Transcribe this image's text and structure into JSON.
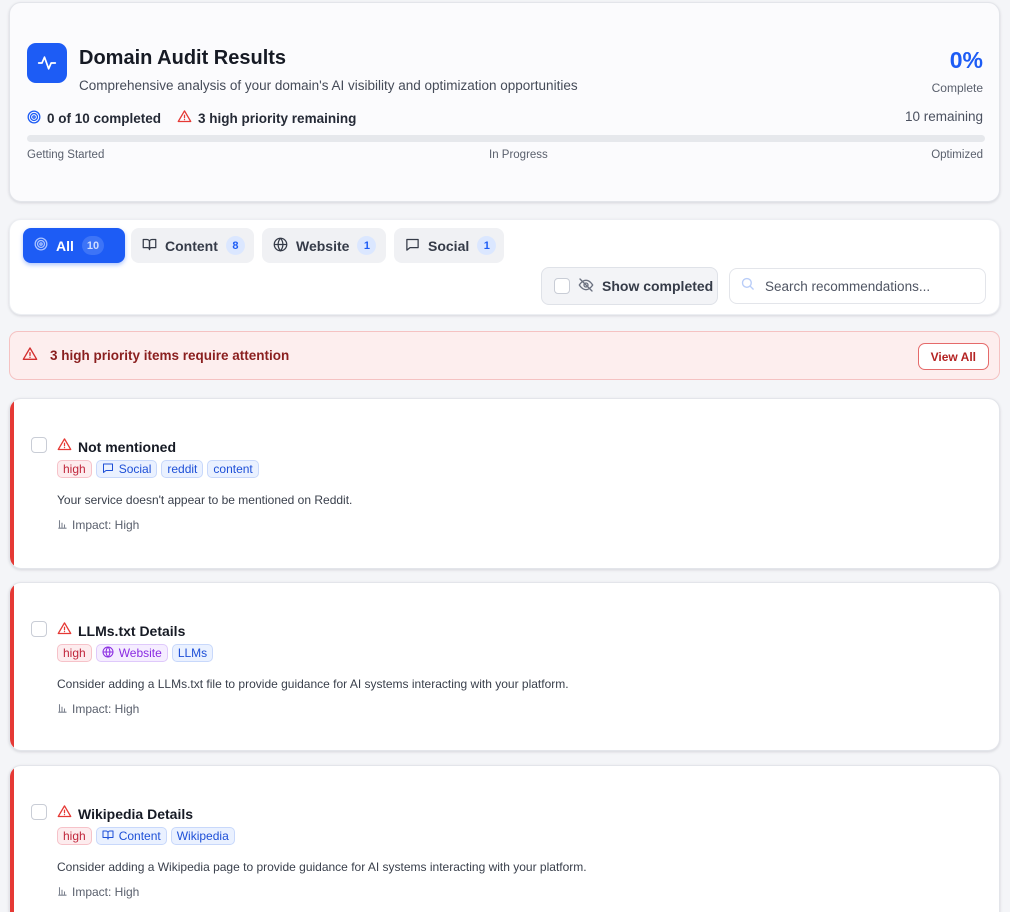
{
  "header": {
    "title": "Domain Audit Results",
    "subtitle": "Comprehensive analysis of your domain's AI visibility and optimization opportunities",
    "percent": "0%",
    "percent_label": "Complete",
    "completed_text": "0 of 10 completed",
    "high_priority_text": "3 high priority remaining",
    "remaining_text": "10 remaining",
    "progress_fraction": 0,
    "stages": [
      "Getting Started",
      "In Progress",
      "Optimized"
    ]
  },
  "tabs": [
    {
      "label": "All",
      "count": "10",
      "icon": "target-icon",
      "active": true
    },
    {
      "label": "Content",
      "count": "8",
      "icon": "book-icon",
      "active": false
    },
    {
      "label": "Website",
      "count": "1",
      "icon": "globe-icon",
      "active": false
    },
    {
      "label": "Social",
      "count": "1",
      "icon": "message-icon",
      "active": false
    }
  ],
  "filters": {
    "show_completed_label": "Show completed",
    "search_placeholder": "Search recommendations..."
  },
  "alert": {
    "text": "3 high priority items require attention",
    "button_label": "View All"
  },
  "recommendations": [
    {
      "title": "Not mentioned",
      "tags": [
        {
          "label": "high",
          "style": "high"
        },
        {
          "label": "Social",
          "style": "blue",
          "icon": "message-icon"
        },
        {
          "label": "reddit",
          "style": "blue"
        },
        {
          "label": "content",
          "style": "blue"
        }
      ],
      "description": "Your service doesn't appear to be mentioned on Reddit.",
      "impact": "Impact: High"
    },
    {
      "title": "LLMs.txt Details",
      "tags": [
        {
          "label": "high",
          "style": "high"
        },
        {
          "label": "Website",
          "style": "purple",
          "icon": "globe-icon"
        },
        {
          "label": "LLMs",
          "style": "blue"
        }
      ],
      "description": "Consider adding a LLMs.txt file to provide guidance for AI systems interacting with your platform.",
      "impact": "Impact: High"
    },
    {
      "title": "Wikipedia Details",
      "tags": [
        {
          "label": "high",
          "style": "high"
        },
        {
          "label": "Content",
          "style": "blue",
          "icon": "book-icon"
        },
        {
          "label": "Wikipedia",
          "style": "blue"
        }
      ],
      "description": "Consider adding a Wikipedia page to provide guidance for AI systems interacting with your platform.",
      "impact": "Impact: High"
    }
  ],
  "colors": {
    "accent": "#1d5cf5",
    "danger": "#e53935",
    "purple": "#8a2be2"
  }
}
